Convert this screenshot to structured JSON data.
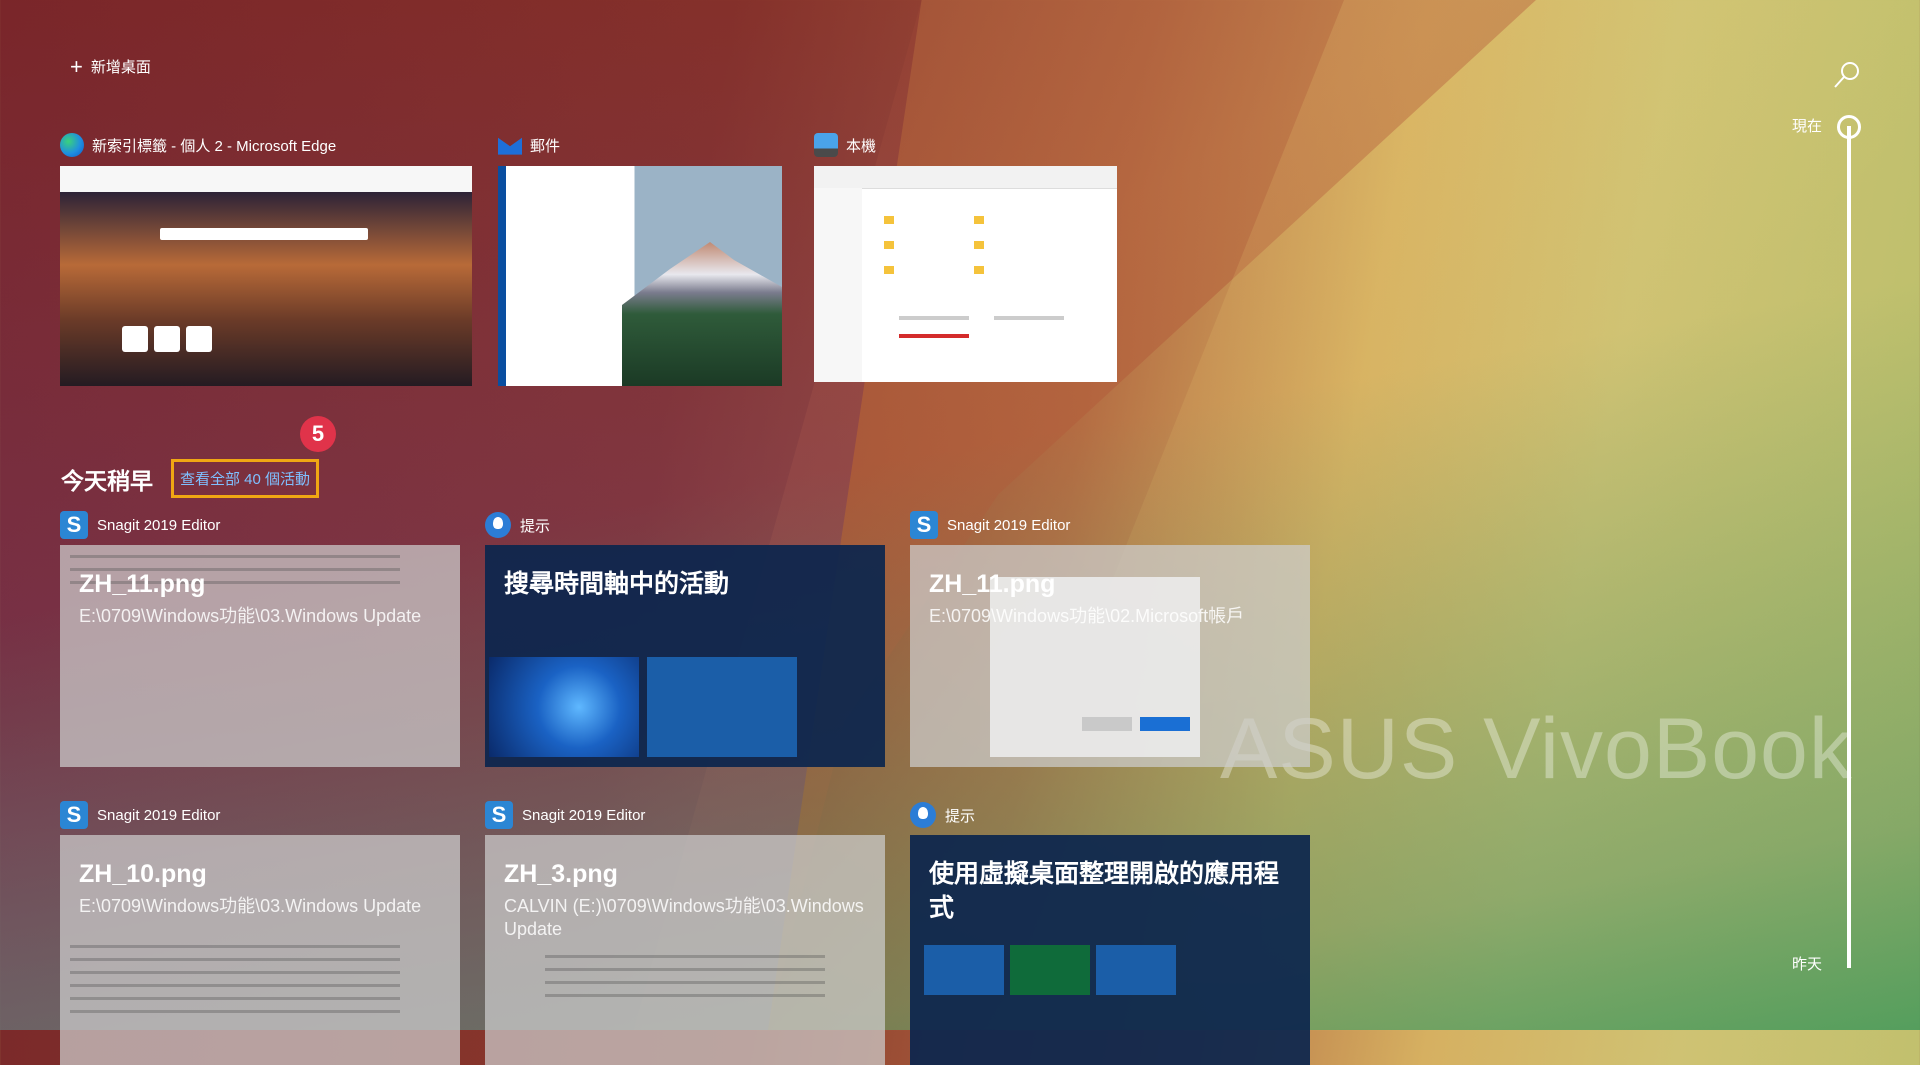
{
  "top": {
    "new_desktop": "新增桌面"
  },
  "windows": [
    {
      "title": "新索引標籤 - 個人 2 - Microsoft Edge",
      "icon": "edge-icon"
    },
    {
      "title": "郵件",
      "icon": "mail-icon"
    },
    {
      "title": "本機",
      "icon": "this-pc-icon"
    }
  ],
  "section": {
    "title": "今天稍早",
    "view_all": "查看全部 40 個活動",
    "badge": "5"
  },
  "activities": [
    {
      "app": "Snagit 2019 Editor",
      "title": "ZH_11.png",
      "subtitle": "E:\\0709\\Windows功能\\03.Windows Update"
    },
    {
      "app": "提示",
      "title": "搜尋時間軸中的活動",
      "subtitle": ""
    },
    {
      "app": "Snagit 2019 Editor",
      "title": "ZH_11.png",
      "subtitle": "E:\\0709\\Windows功能\\02.Microsoft帳戶"
    },
    {
      "app": "Snagit 2019 Editor",
      "title": "ZH_10.png",
      "subtitle": "E:\\0709\\Windows功能\\03.Windows Update"
    },
    {
      "app": "Snagit 2019 Editor",
      "title": "ZH_3.png",
      "subtitle": "CALVIN (E:)\\0709\\Windows功能\\03.Windows Update"
    },
    {
      "app": "提示",
      "title": "使用虛擬桌面整理開啟的應用程式",
      "subtitle": ""
    }
  ],
  "timeline": {
    "now": "現在",
    "yesterday": "昨天"
  },
  "watermark": "ASUS VivoBook"
}
